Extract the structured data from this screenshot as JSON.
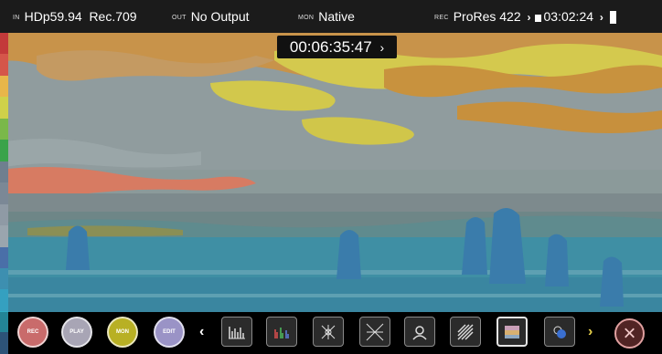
{
  "status_bar": {
    "input": {
      "tag": "IN",
      "format": "HDp59.94",
      "colorspace": "Rec.709"
    },
    "output": {
      "tag": "OUT",
      "value": "No Output"
    },
    "monitor": {
      "tag": "MON",
      "value": "Native"
    },
    "record": {
      "tag": "REC",
      "codec": "ProRes 422",
      "time_remaining": "03:02:24"
    },
    "icons": [
      "chevron-right-icon",
      "media-battery-icon",
      "chevron-right-icon",
      "battery-icon"
    ]
  },
  "timecode": {
    "value": "00:06:35:47",
    "arrow": "›"
  },
  "false_color_scale": [
    "#c33a3a",
    "#d5564a",
    "#e8b64a",
    "#cfd14a",
    "#7ab84a",
    "#3aa34a",
    "#6f7f8f",
    "#7b8896",
    "#8f9aa5",
    "#9aa5ae",
    "#4a6fa8",
    "#3d8fb0",
    "#35a0c0",
    "#2fb0c8",
    "#3d6fa0"
  ],
  "mode_buttons": [
    {
      "label": "REC",
      "color": "#c96b6b"
    },
    {
      "label": "PLAY",
      "color": "#a8a5b5"
    },
    {
      "label": "MON",
      "color": "#b8b024"
    },
    {
      "label": "EDIT",
      "color": "#9a93c6"
    }
  ],
  "nav": {
    "prev": "‹",
    "next": "›"
  },
  "tools": [
    {
      "name": "waveform",
      "active": false
    },
    {
      "name": "rgb-parade",
      "active": false
    },
    {
      "name": "vectorscope-zoom",
      "active": false
    },
    {
      "name": "vectorscope",
      "active": false
    },
    {
      "name": "focus-peaking",
      "active": false
    },
    {
      "name": "zebra",
      "active": false
    },
    {
      "name": "false-color",
      "active": true
    },
    {
      "name": "blue-only",
      "active": false
    }
  ],
  "close": {
    "symbol": "×"
  }
}
